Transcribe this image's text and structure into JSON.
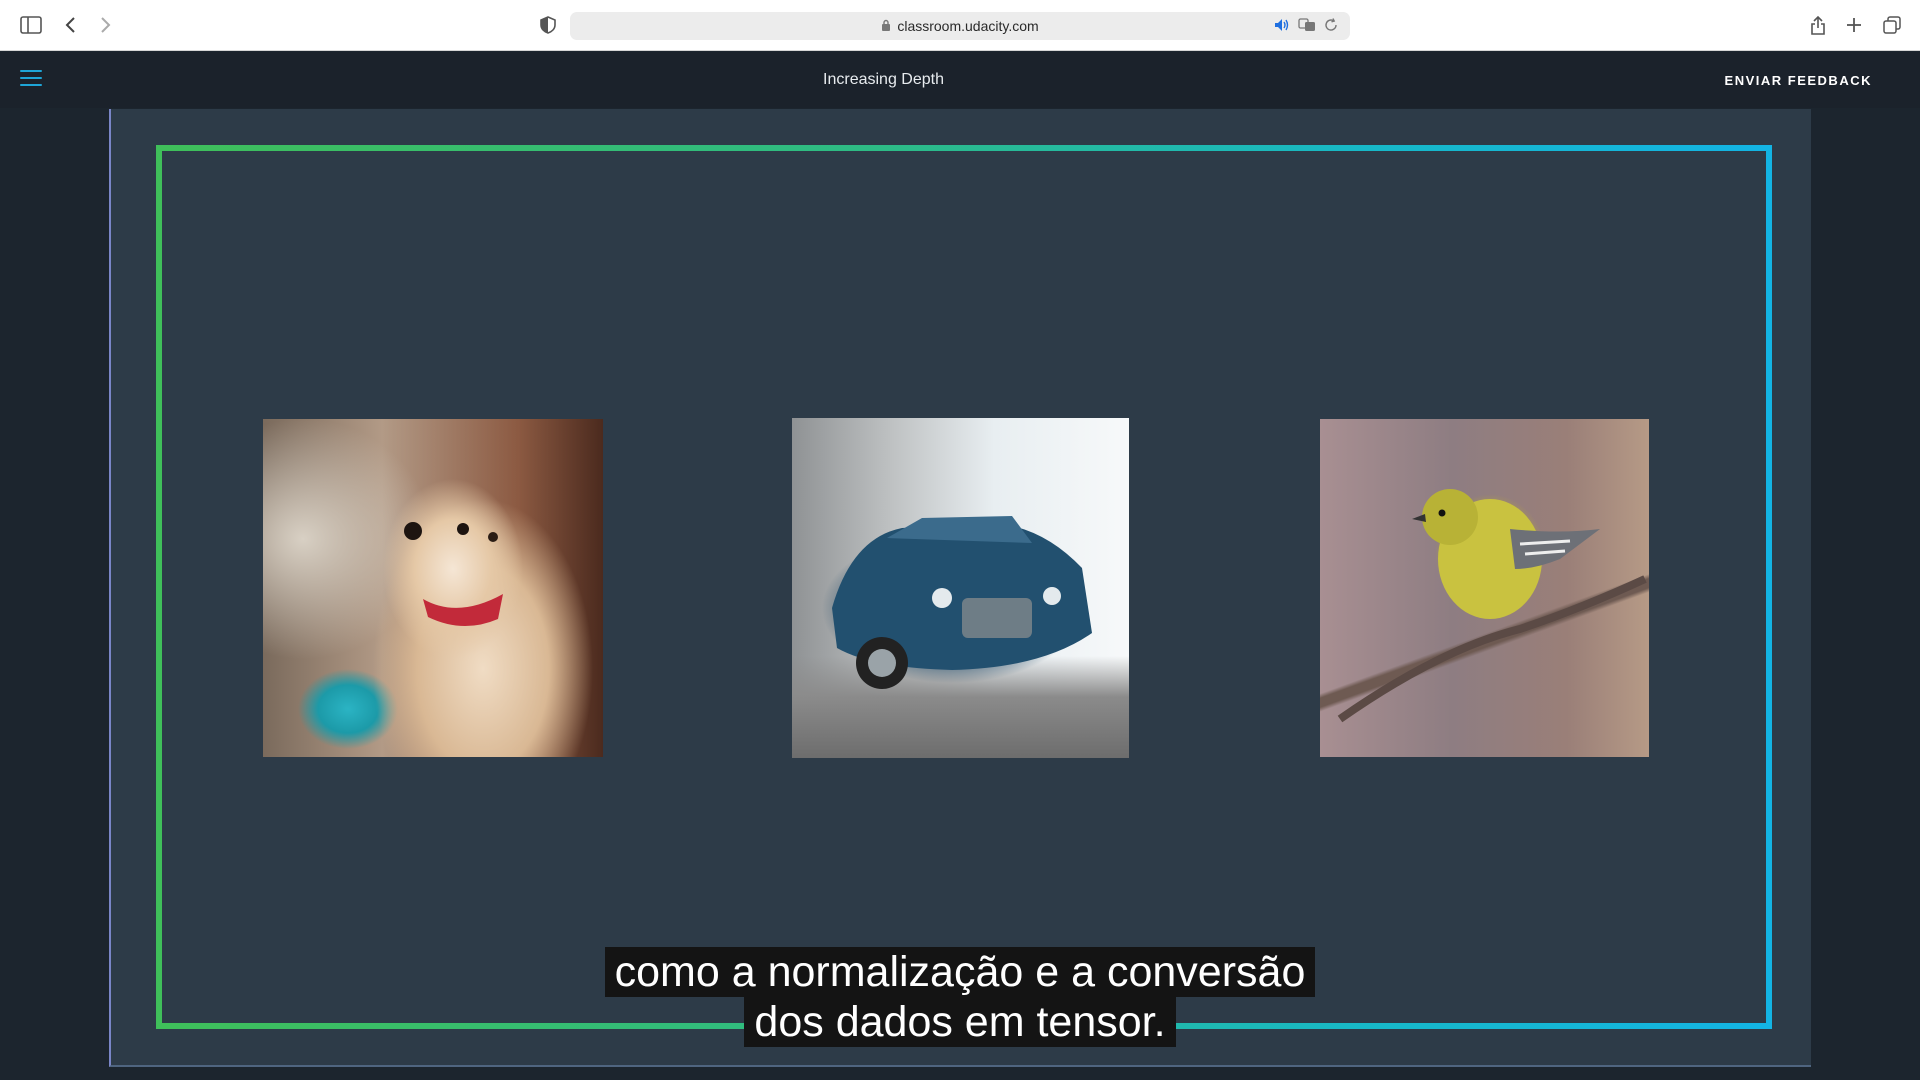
{
  "browser": {
    "url": "classroom.udacity.com"
  },
  "header": {
    "lesson_title": "Increasing Depth",
    "feedback_label": "ENVIAR FEEDBACK"
  },
  "slide": {
    "images": [
      {
        "subject": "puppy"
      },
      {
        "subject": "car"
      },
      {
        "subject": "bird"
      }
    ]
  },
  "captions": {
    "line1": "como a normalização e a conversão",
    "line2": "dos dados em tensor."
  },
  "colors": {
    "accent": "#1ea5d7",
    "frame_bg": "#2d3b48",
    "header_bg": "#1b222b"
  }
}
